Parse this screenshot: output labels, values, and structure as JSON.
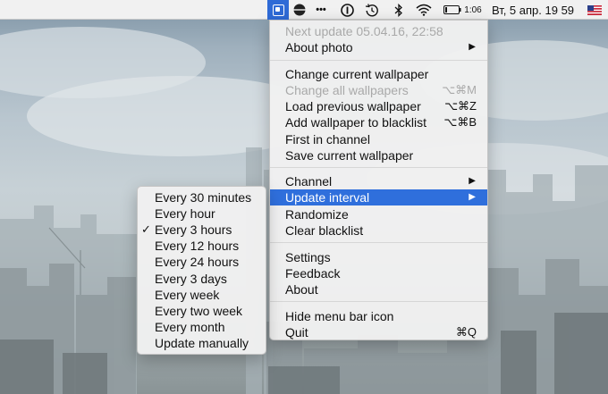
{
  "menubar": {
    "more_dots": "•••",
    "battery_time": "1:06",
    "clock": "Вт, 5 апр. 19 59"
  },
  "main_menu": {
    "next_update": "Next update 05.04.16, 22:58",
    "about_photo": "About photo",
    "change_current": "Change current wallpaper",
    "change_all": "Change all wallpapers",
    "change_all_shortcut": "⌥⌘M",
    "load_previous": "Load previous wallpaper",
    "load_previous_shortcut": "⌥⌘Z",
    "add_blacklist": "Add wallpaper to blacklist",
    "add_blacklist_shortcut": "⌥⌘B",
    "first_in_channel": "First in channel",
    "save_current": "Save current wallpaper",
    "channel": "Channel",
    "update_interval": "Update interval",
    "randomize": "Randomize",
    "clear_blacklist": "Clear blacklist",
    "settings": "Settings",
    "feedback": "Feedback",
    "about": "About",
    "hide_icon": "Hide menu bar icon",
    "quit": "Quit",
    "quit_shortcut": "⌘Q"
  },
  "submenu": {
    "checkmark": "✓",
    "items": [
      "Every 30 minutes",
      "Every hour",
      "Every 3 hours",
      "Every 12 hours",
      "Every 24 hours",
      "Every 3 days",
      "Every week",
      "Every two week",
      "Every month",
      "Update manually"
    ],
    "selected": "Every 3 hours"
  },
  "colors": {
    "highlight": "#2f6fdc",
    "disabled_text": "#a9a9a9",
    "menubar_bg": "#f1f1f1"
  }
}
